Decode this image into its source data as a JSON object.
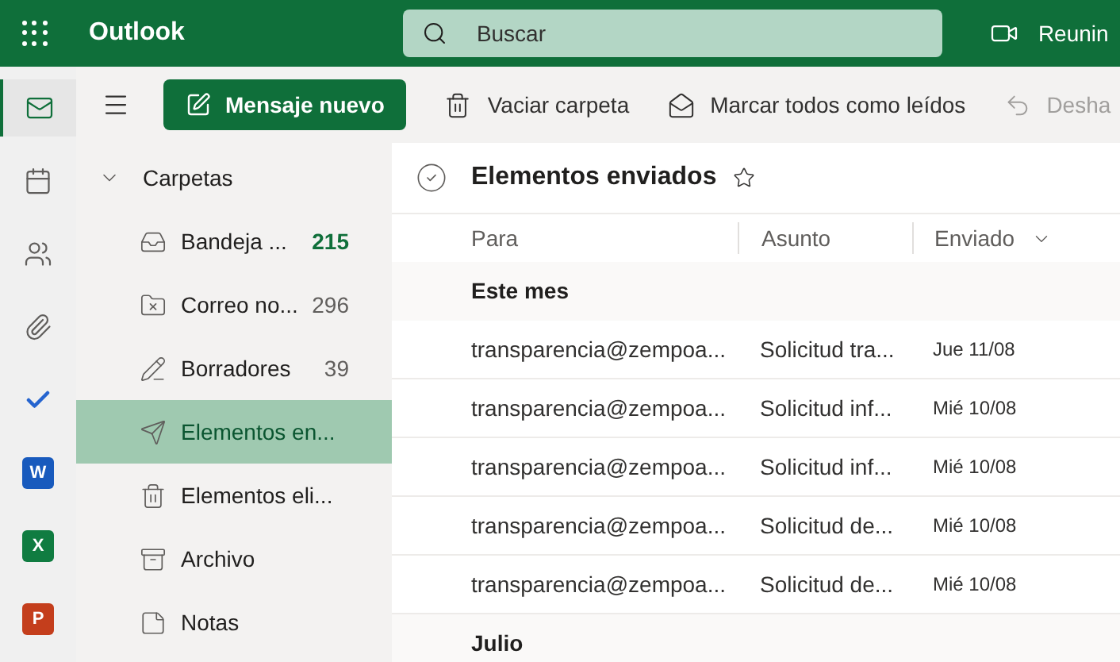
{
  "top_bar": {
    "app_name": "Outlook",
    "search": {
      "placeholder": "Buscar"
    },
    "meeting_button": "Reunin"
  },
  "rail": [
    {
      "kind": "mail",
      "selected": true
    },
    {
      "kind": "calendar",
      "selected": false
    },
    {
      "kind": "people",
      "selected": false
    },
    {
      "kind": "files",
      "selected": false
    },
    {
      "kind": "todo",
      "selected": false
    },
    {
      "kind": "word",
      "badge": "W",
      "color": "#185abd",
      "selected": false
    },
    {
      "kind": "excel",
      "badge": "X",
      "color": "#107c41",
      "selected": false
    },
    {
      "kind": "powerpoint",
      "badge": "P",
      "color": "#c43e1c",
      "selected": false
    }
  ],
  "toolbar": {
    "new_message": "Mensaje nuevo",
    "actions": [
      {
        "kind": "empty",
        "label": "Vaciar carpeta",
        "disabled": false
      },
      {
        "kind": "mark_read",
        "label": "Marcar todos como leídos",
        "disabled": false
      },
      {
        "kind": "undo",
        "label": "Desha",
        "disabled": true
      }
    ]
  },
  "folders": {
    "header": "Carpetas",
    "expanded": true,
    "items": [
      {
        "kind": "inbox",
        "label": "Bandeja ...",
        "count": "215",
        "unread": true,
        "selected": false
      },
      {
        "kind": "junk",
        "label": "Correo no...",
        "count": "296",
        "unread": false,
        "selected": false
      },
      {
        "kind": "drafts",
        "label": "Borradores",
        "count": "39",
        "unread": false,
        "selected": false
      },
      {
        "kind": "sent",
        "label": "Elementos en...",
        "selected": true
      },
      {
        "kind": "deleted",
        "label": "Elementos eli...",
        "selected": false
      },
      {
        "kind": "archive",
        "label": "Archivo",
        "selected": false
      },
      {
        "kind": "notes",
        "label": "Notas",
        "selected": false
      }
    ]
  },
  "message_list": {
    "title": "Elementos enviados",
    "favorite": false,
    "columns": [
      {
        "label": "Para",
        "sorted": false
      },
      {
        "label": "Asunto",
        "sorted": false
      },
      {
        "label": "Enviado",
        "sorted": true
      }
    ],
    "groups": [
      {
        "label": "Este mes",
        "rows": [
          {
            "to": "transparencia@zempoa...",
            "subject": "Solicitud tra...",
            "sent": "Jue 11/08"
          },
          {
            "to": "transparencia@zempoa...",
            "subject": "Solicitud inf...",
            "sent": "Mié 10/08"
          },
          {
            "to": "transparencia@zempoa...",
            "subject": "Solicitud inf...",
            "sent": "Mié 10/08"
          },
          {
            "to": "transparencia@zempoa...",
            "subject": "Solicitud de...",
            "sent": "Mié 10/08"
          },
          {
            "to": "transparencia@zempoa...",
            "subject": "Solicitud de...",
            "sent": "Mié 10/08"
          }
        ]
      },
      {
        "label": "Julio"
      }
    ]
  }
}
